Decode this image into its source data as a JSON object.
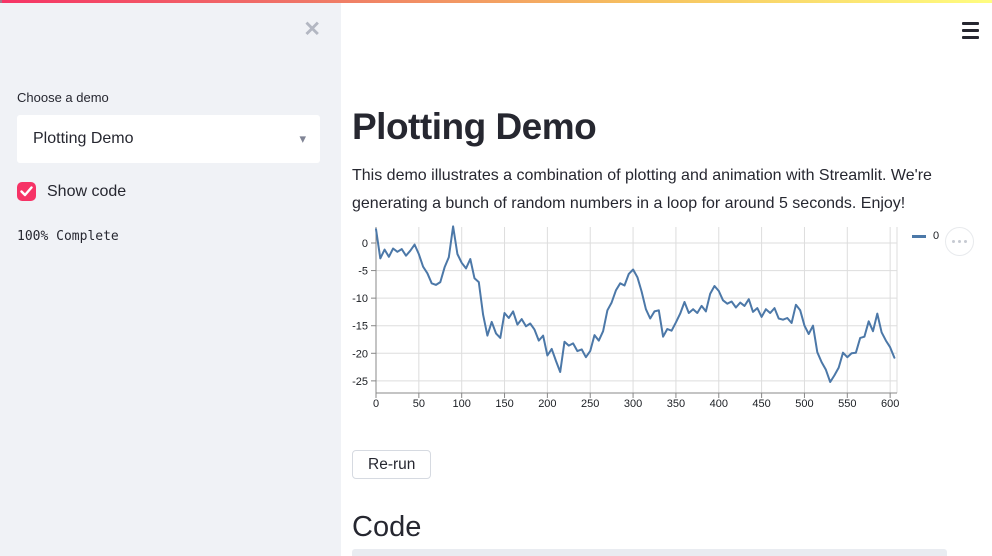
{
  "colors": {
    "accent": "#f63366",
    "gradient_left": "#f63366",
    "gradient_right": "#fffd80",
    "sidebar_bg": "#f0f2f6",
    "text": "#262730",
    "chart_line": "#4c78a8",
    "gridline": "#dddddd",
    "axis": "#888888"
  },
  "sidebar": {
    "close_icon": "✕",
    "select_label": "Choose a demo",
    "select_value": "Plotting Demo",
    "caret_icon": "▾",
    "checkbox_label": "Show code",
    "checkbox_checked": true,
    "progress_text": "100% Complete"
  },
  "main": {
    "title": "Plotting Demo",
    "description": "This demo illustrates a combination of plotting and animation with Streamlit. We're generating a bunch of random numbers in a loop for around 5 seconds. Enjoy!",
    "rerun_button": "Re-run",
    "code_heading": "Code"
  },
  "chart_data": {
    "type": "line",
    "title": "",
    "xlabel": "",
    "ylabel": "",
    "legend_label": "0",
    "legend_position": "top-right",
    "grid": true,
    "line_color": "#4c78a8",
    "xlim": [
      0,
      608
    ],
    "ylim": [
      -27.2,
      2.9
    ],
    "x_ticks": [
      0,
      50,
      100,
      150,
      200,
      250,
      300,
      350,
      400,
      450,
      500,
      550,
      600
    ],
    "y_ticks": [
      0,
      -5,
      -10,
      -15,
      -20,
      -25
    ],
    "x": [
      0,
      5,
      10,
      15,
      20,
      25,
      30,
      35,
      40,
      45,
      50,
      55,
      60,
      65,
      70,
      75,
      80,
      85,
      90,
      95,
      100,
      105,
      110,
      115,
      120,
      125,
      130,
      135,
      140,
      145,
      150,
      155,
      160,
      165,
      170,
      175,
      180,
      185,
      190,
      195,
      200,
      205,
      210,
      215,
      220,
      225,
      230,
      235,
      240,
      245,
      250,
      255,
      260,
      265,
      270,
      275,
      280,
      285,
      290,
      295,
      300,
      305,
      310,
      315,
      320,
      325,
      330,
      335,
      340,
      345,
      350,
      355,
      360,
      365,
      370,
      375,
      380,
      385,
      390,
      395,
      400,
      405,
      410,
      415,
      420,
      425,
      430,
      435,
      440,
      445,
      450,
      455,
      460,
      465,
      470,
      475,
      480,
      485,
      490,
      495,
      500,
      505,
      510,
      515,
      520,
      525,
      530,
      535,
      540,
      545,
      550,
      555,
      560,
      565,
      570,
      575,
      580,
      585,
      590,
      595,
      600,
      605
    ],
    "series": [
      {
        "name": "0",
        "values": [
          2.5,
          -2.8,
          -1.2,
          -2.5,
          -1.0,
          -1.6,
          -1.1,
          -2.3,
          -1.4,
          -0.3,
          -2.0,
          -4.3,
          -5.5,
          -7.3,
          -7.6,
          -7.1,
          -4.4,
          -2.6,
          3.0,
          -2.0,
          -3.6,
          -4.6,
          -2.9,
          -6.4,
          -7.1,
          -13.0,
          -16.8,
          -14.3,
          -16.4,
          -17.2,
          -12.7,
          -13.6,
          -12.4,
          -14.8,
          -13.8,
          -15.1,
          -14.6,
          -15.7,
          -17.7,
          -16.8,
          -20.4,
          -19.2,
          -21.4,
          -23.4,
          -17.9,
          -18.6,
          -18.2,
          -19.6,
          -19.3,
          -20.7,
          -19.6,
          -16.7,
          -17.7,
          -16.0,
          -12.2,
          -10.8,
          -8.6,
          -7.3,
          -7.7,
          -5.6,
          -4.8,
          -6.2,
          -8.8,
          -12.0,
          -13.7,
          -12.4,
          -12.2,
          -17.0,
          -15.6,
          -15.9,
          -14.4,
          -12.8,
          -10.7,
          -12.7,
          -12.0,
          -12.7,
          -11.4,
          -12.4,
          -9.2,
          -7.8,
          -8.7,
          -10.4,
          -11.0,
          -10.6,
          -11.7,
          -10.8,
          -11.4,
          -10.2,
          -12.5,
          -11.8,
          -13.4,
          -12.0,
          -12.7,
          -11.8,
          -13.7,
          -13.9,
          -13.6,
          -14.5,
          -11.2,
          -12.2,
          -15.0,
          -16.5,
          -15.0,
          -19.8,
          -21.6,
          -23.0,
          -25.2,
          -24.0,
          -22.6,
          -19.9,
          -20.7,
          -20.0,
          -19.9,
          -17.2,
          -17.0,
          -14.2,
          -16.0,
          -12.8,
          -16.2,
          -17.7,
          -18.9,
          -20.8
        ]
      }
    ]
  }
}
